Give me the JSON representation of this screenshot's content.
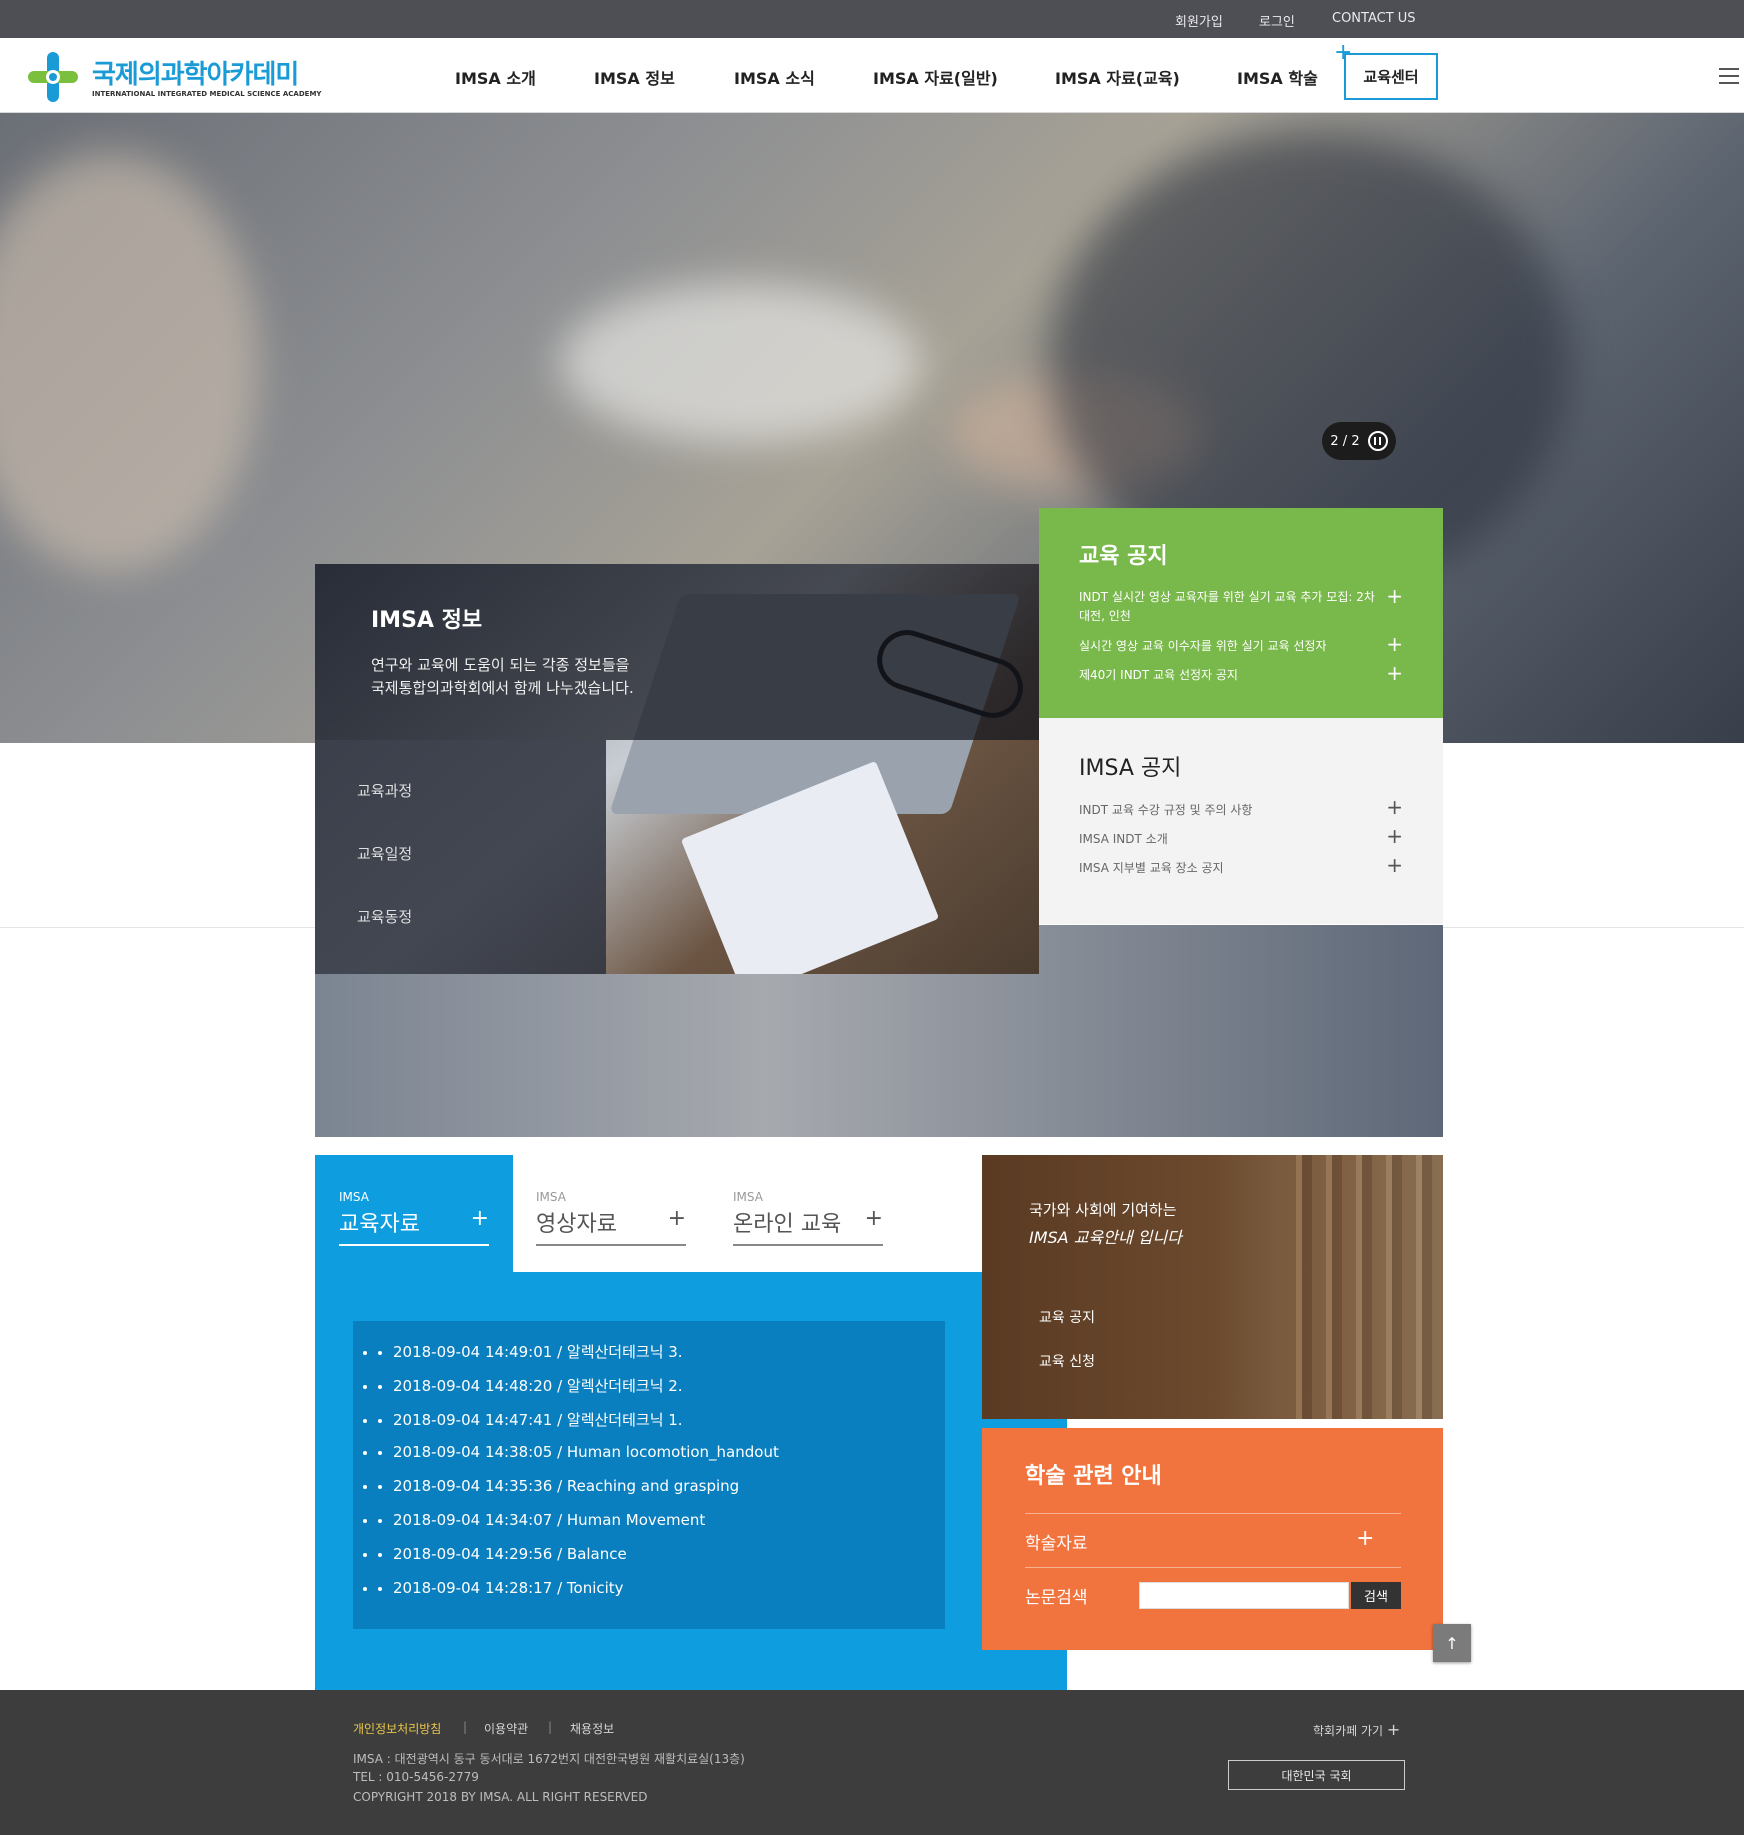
{
  "top_links": [
    "회원가입",
    "로그인",
    "CONTACT US"
  ],
  "logo": {
    "title": "국제의과학아카데미",
    "subtitle": "INTERNATIONAL INTEGRATED MEDICAL SCIENCE ACADEMY"
  },
  "nav": [
    "IMSA 소개",
    "IMSA 정보",
    "IMSA 소식",
    "IMSA 자료(일반)",
    "IMSA 자료(교육)",
    "IMSA 학술"
  ],
  "nav_highlight": "교육센터",
  "hero": {
    "counter": "2 / 2"
  },
  "info_panel": {
    "title": "IMSA 정보",
    "desc_line1": "연구와 교육에 도움이 되는 각종 정보들을",
    "desc_line2": "국제통합의과학회에서 함께 나누겠습니다.",
    "menu": [
      "교육과정",
      "교육일정",
      "교육동정"
    ]
  },
  "edu_notice": {
    "title": "교육 공지",
    "items": [
      "INDT 실시간 영상 교육자를 위한 실기 교육 추가 모집: 2차 대전, 인천",
      "실시간 영상 교육 이수자를 위한 실기 교육 선정자",
      "제40기 INDT 교육 선정자 공지"
    ]
  },
  "imsa_notice": {
    "title": "IMSA 공지",
    "items": [
      "INDT 교육 수강 규정 및 주의 사항",
      "IMSA INDT 소개",
      "IMSA 지부별 교육 장소 공지"
    ]
  },
  "tabs": [
    {
      "small": "IMSA",
      "big": "교육자료"
    },
    {
      "small": "IMSA",
      "big": "영상자료"
    },
    {
      "small": "IMSA",
      "big": "온라인 교육"
    }
  ],
  "recent_items": [
    "2018-09-04 14:49:01 / 알렉산더테크닉 3.",
    "2018-09-04 14:48:20 / 알렉산더테크닉 2.",
    "2018-09-04 14:47:41 / 알렉산더테크닉 1.",
    "2018-09-04 14:38:05 / Human locomotion_handout",
    "2018-09-04 14:35:36 / Reaching and grasping",
    "2018-09-04 14:34:07 / Human Movement",
    "2018-09-04 14:29:56 / Balance",
    "2018-09-04 14:28:17 / Tonicity"
  ],
  "library_card": {
    "line1": "국가와 사회에 기여하는",
    "line2": "IMSA 교육안내 입니다",
    "links": [
      "교육 공지",
      "교육 신청"
    ]
  },
  "academic": {
    "title": "학술 관련 안내",
    "link": "학술자료",
    "search_label": "논문검색",
    "search_value": "",
    "search_button": "검색"
  },
  "footer": {
    "links": [
      "개인정보처리방침",
      "이용약관",
      "채용정보"
    ],
    "address": "IMSA : 대전광역시 동구 동서대로 1672번지 대전한국병원 재활치료실(13층)",
    "tel": "TEL : 010-5456-2779",
    "copyright": "COPYRIGHT 2018 BY IMSA. ALL RIGHT RESERVED",
    "cafe": "학회카페 가기",
    "assembly": "대한민국 국회"
  },
  "colors": {
    "brand_blue": "#1a9bd6",
    "edu_green": "#79b84b",
    "tab_blue": "#0e9ee0",
    "list_blue": "#0a7fbf",
    "academic_orange": "#f1733d",
    "footer_gray": "#3d3d3d"
  },
  "icons": {
    "logo": "cross-logo-icon",
    "menu": "hamburger-icon",
    "pause": "pause-icon",
    "expand": "plus-icon",
    "top": "arrow-up-icon"
  }
}
